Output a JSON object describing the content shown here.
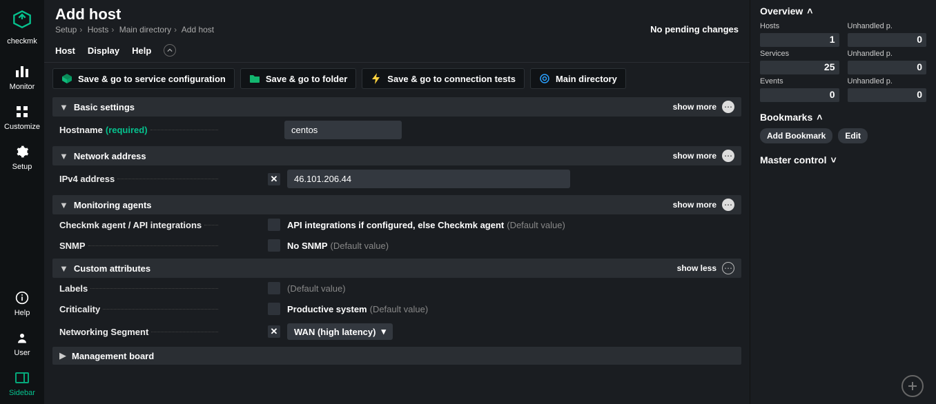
{
  "brand": "checkmk",
  "rail": {
    "monitor": "Monitor",
    "customize": "Customize",
    "setup": "Setup",
    "help": "Help",
    "user": "User",
    "sidebar": "Sidebar"
  },
  "header": {
    "title": "Add host",
    "crumbs": [
      "Setup",
      "Hosts",
      "Main directory",
      "Add host"
    ],
    "pending": "No pending changes"
  },
  "menu": {
    "host": "Host",
    "display": "Display",
    "help": "Help"
  },
  "toolbar": {
    "save_svc": "Save & go to service configuration",
    "save_folder": "Save & go to folder",
    "save_conn": "Save & go to connection tests",
    "main_dir": "Main directory"
  },
  "sections": {
    "basic": {
      "title": "Basic settings",
      "showmore": "show more",
      "hostname_label": "Hostname",
      "required": "(required)",
      "hostname_value": "centos"
    },
    "network": {
      "title": "Network address",
      "showmore": "show more",
      "ipv4_label": "IPv4 address",
      "ipv4_value": "46.101.206.44"
    },
    "monagents": {
      "title": "Monitoring agents",
      "showmore": "show more",
      "agent_label": "Checkmk agent / API integrations",
      "agent_value": "API integrations if configured, else Checkmk agent",
      "snmp_label": "SNMP",
      "snmp_value": "No SNMP",
      "default": "(Default value)"
    },
    "custom": {
      "title": "Custom attributes",
      "showless": "show less",
      "labels_label": "Labels",
      "criticality_label": "Criticality",
      "criticality_value": "Productive system",
      "netseg_label": "Networking Segment",
      "netseg_value": "WAN (high latency)",
      "default": "(Default value)"
    },
    "mgmt": {
      "title": "Management board"
    }
  },
  "overview": {
    "title": "Overview",
    "labels": {
      "hosts": "Hosts",
      "unhandled": "Unhandled p.",
      "services": "Services",
      "events": "Events"
    },
    "values": {
      "hosts": "1",
      "hosts_u": "0",
      "services": "25",
      "services_u": "0",
      "events": "0",
      "events_u": "0"
    }
  },
  "bookmarks": {
    "title": "Bookmarks",
    "add": "Add Bookmark",
    "edit": "Edit"
  },
  "master": {
    "title": "Master control"
  }
}
